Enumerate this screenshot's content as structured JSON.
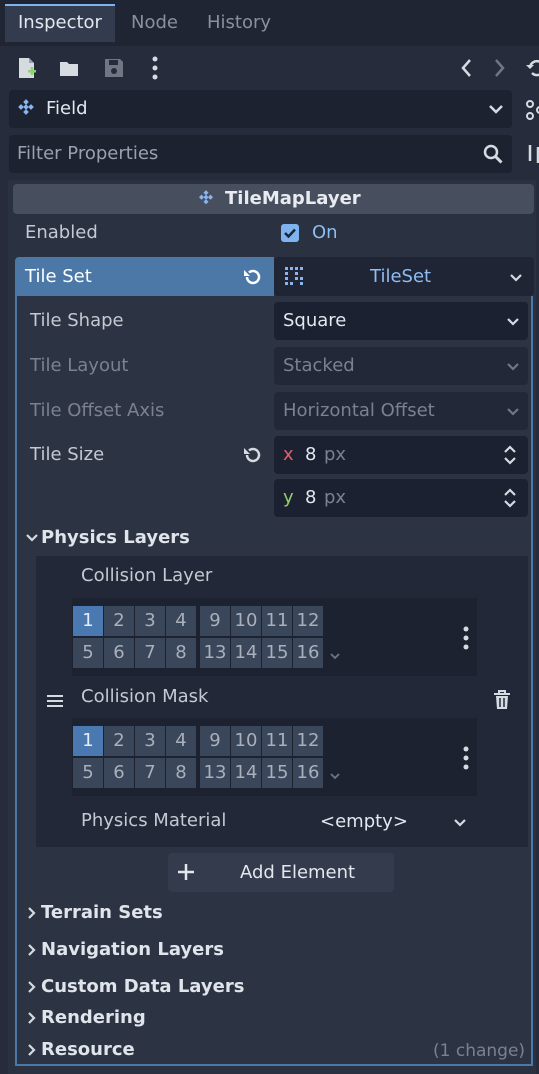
{
  "tabs": [
    "Inspector",
    "Node",
    "History"
  ],
  "toolbar": {
    "new_icon": "new-resource-icon",
    "open_icon": "open-icon",
    "save_icon": "save-icon",
    "more_icon": "more-vertical-icon",
    "back_icon": "chevron-left-icon",
    "forward_icon": "chevron-right-icon",
    "history_icon": "history-icon"
  },
  "object_selector": {
    "label": "Field",
    "icon": "tilemap-layer-icon"
  },
  "filter": {
    "placeholder": "Filter Properties"
  },
  "header": {
    "title": "TileMapLayer"
  },
  "enabled": {
    "label": "Enabled",
    "value": "On",
    "checked": true
  },
  "tileset": {
    "label": "Tile Set",
    "value": "TileSet"
  },
  "tile_shape": {
    "label": "Tile Shape",
    "value": "Square"
  },
  "tile_layout": {
    "label": "Tile Layout",
    "value": "Stacked"
  },
  "tile_offset_axis": {
    "label": "Tile Offset Axis",
    "value": "Horizontal Offset"
  },
  "tile_size": {
    "label": "Tile Size",
    "x_label": "x",
    "x_value": "8",
    "y_label": "y",
    "y_value": "8",
    "unit": "px"
  },
  "physics_layers": {
    "title": "Physics Layers",
    "collision_layer": {
      "label": "Collision Layer",
      "bits_row1": [
        "1",
        "2",
        "3",
        "4",
        "9",
        "10",
        "11",
        "12"
      ],
      "bits_row2": [
        "5",
        "6",
        "7",
        "8",
        "13",
        "14",
        "15",
        "16"
      ],
      "active": [
        "1"
      ]
    },
    "collision_mask": {
      "label": "Collision Mask",
      "bits_row1": [
        "1",
        "2",
        "3",
        "4",
        "9",
        "10",
        "11",
        "12"
      ],
      "bits_row2": [
        "5",
        "6",
        "7",
        "8",
        "13",
        "14",
        "15",
        "16"
      ],
      "active": [
        "1"
      ]
    },
    "physics_material": {
      "label": "Physics Material",
      "value": "<empty>"
    },
    "add_element": "Add Element"
  },
  "sections": [
    "Terrain Sets",
    "Navigation Layers",
    "Custom Data Layers",
    "Rendering",
    "Resource"
  ],
  "resource_note": "(1 change)",
  "colors": {
    "accent": "#7eb3f0",
    "x_axis": "#e0616b",
    "y_axis": "#8fd070",
    "active_bit": "#4a78b0"
  }
}
